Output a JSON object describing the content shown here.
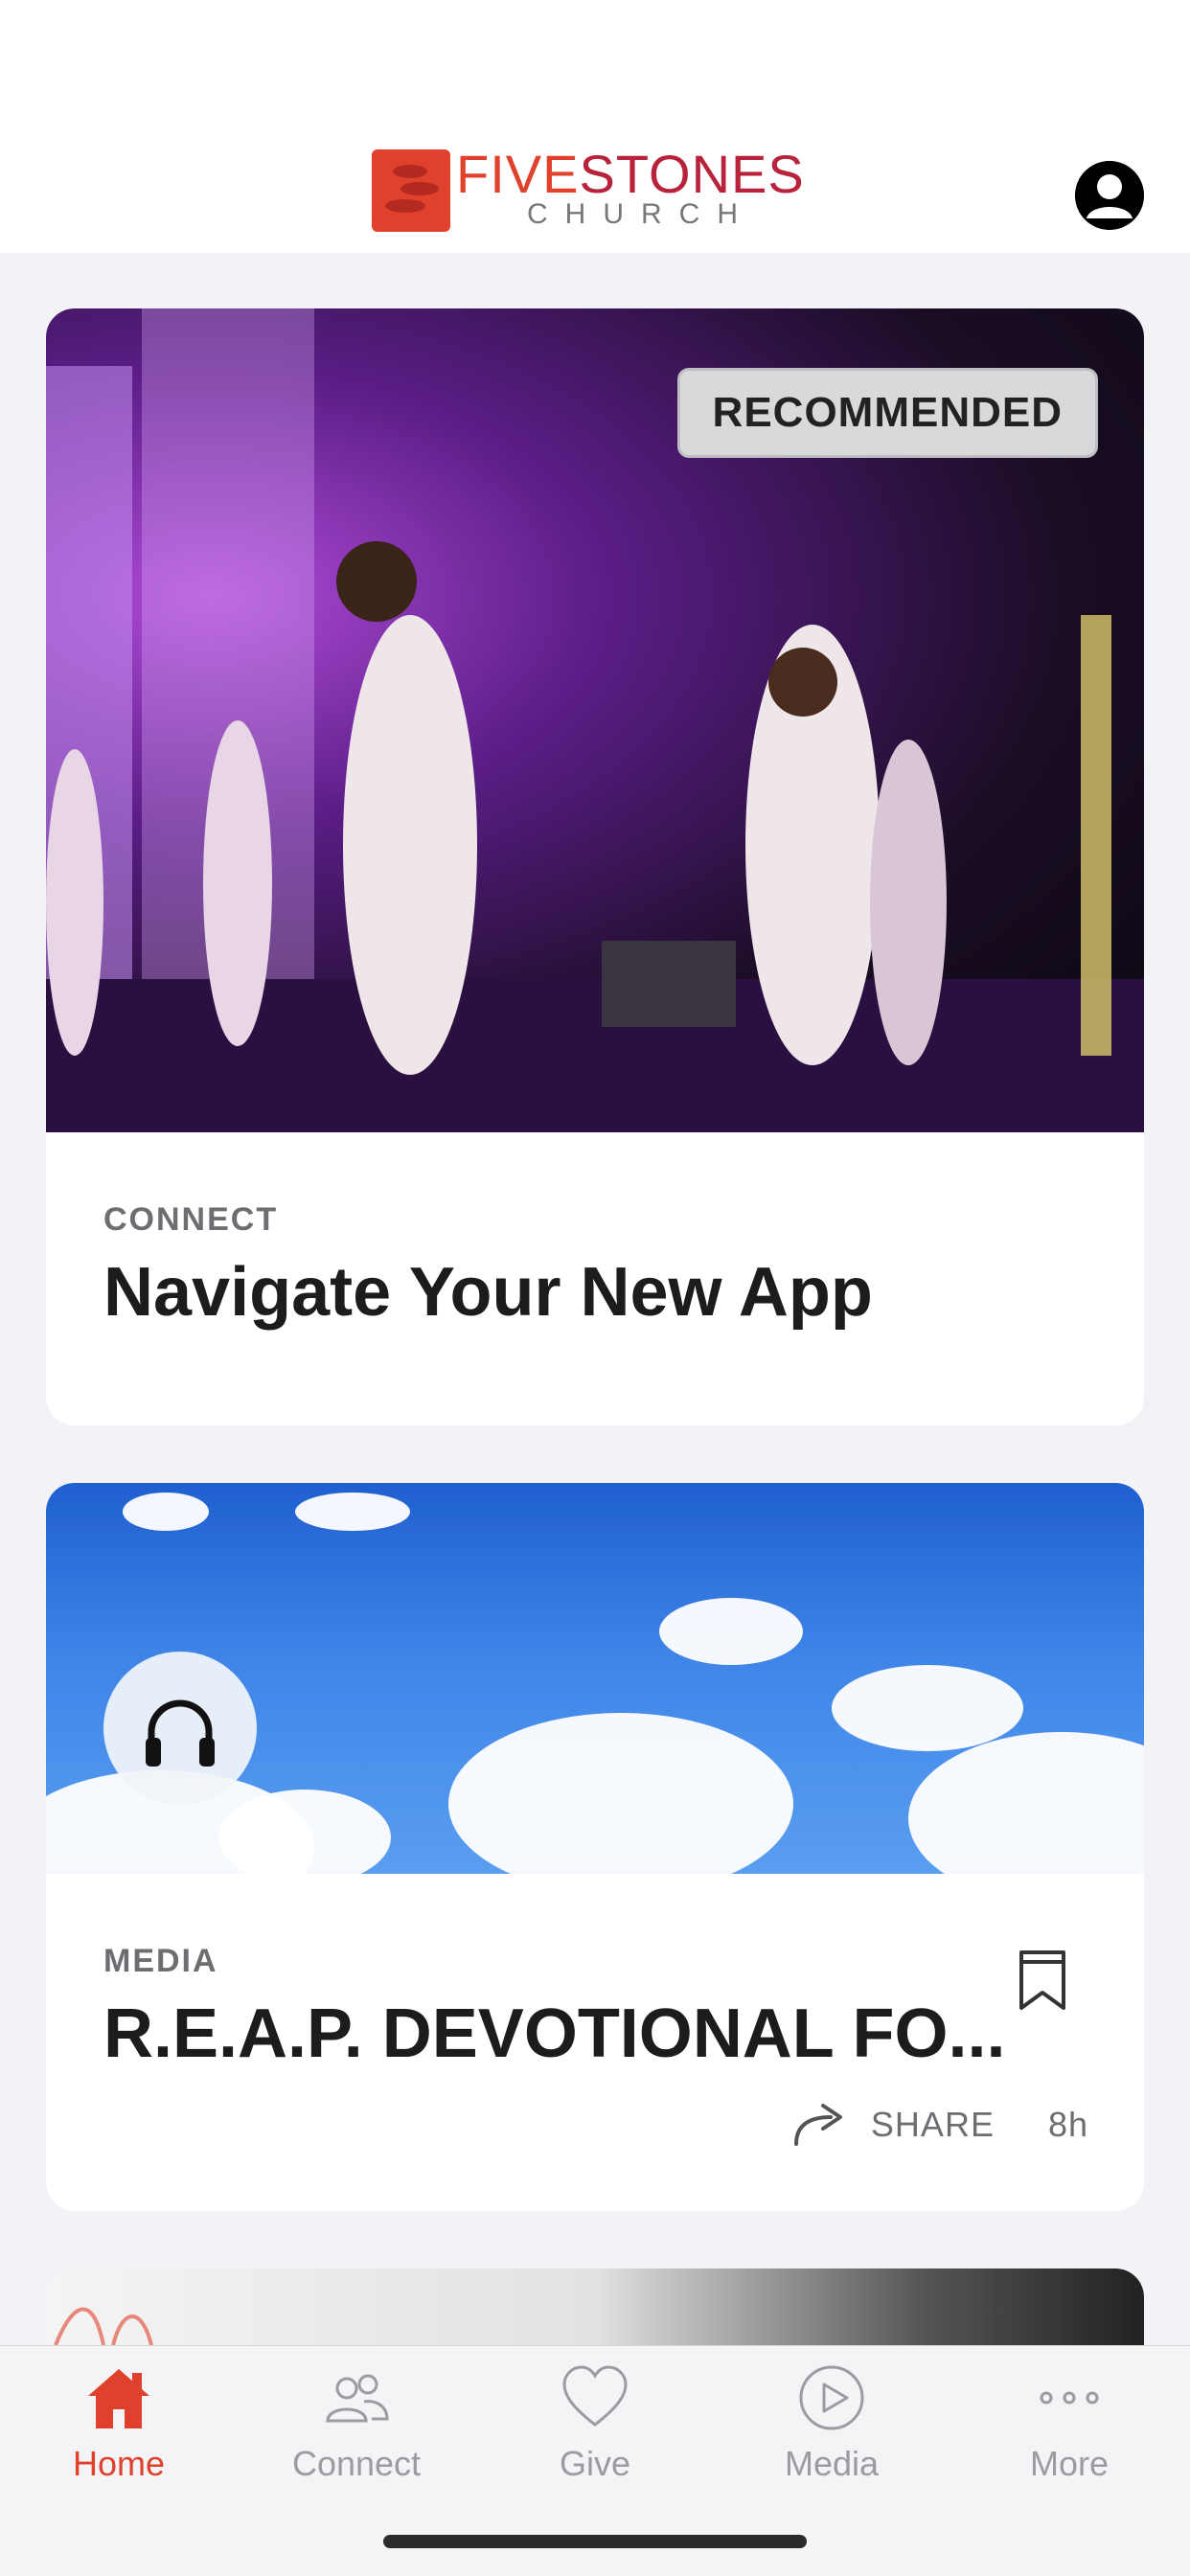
{
  "header": {
    "logo_word_1": "FIVE",
    "logo_word_2": "STONES",
    "logo_sub": "CHURCH",
    "profile_icon": "person-circle-icon"
  },
  "colors": {
    "brand": "#e0412c",
    "brand_dark": "#b8233b",
    "tab_inactive": "#9b9ba0"
  },
  "feed": [
    {
      "badge": "RECOMMENDED",
      "category": "CONNECT",
      "title": "Navigate Your New App"
    },
    {
      "media_icon": "headphones-icon",
      "category": "MEDIA",
      "title": "R.E.A.P. DEVOTIONAL FO...",
      "bookmark_icon": "bookmark-icon",
      "share_label": "SHARE",
      "time_ago": "8h"
    }
  ],
  "tabbar": {
    "tabs": [
      {
        "label": "Home",
        "icon": "home-icon",
        "active": true
      },
      {
        "label": "Connect",
        "icon": "people-icon",
        "active": false
      },
      {
        "label": "Give",
        "icon": "heart-icon",
        "active": false
      },
      {
        "label": "Media",
        "icon": "play-circle-icon",
        "active": false
      },
      {
        "label": "More",
        "icon": "more-dots-icon",
        "active": false
      }
    ]
  }
}
